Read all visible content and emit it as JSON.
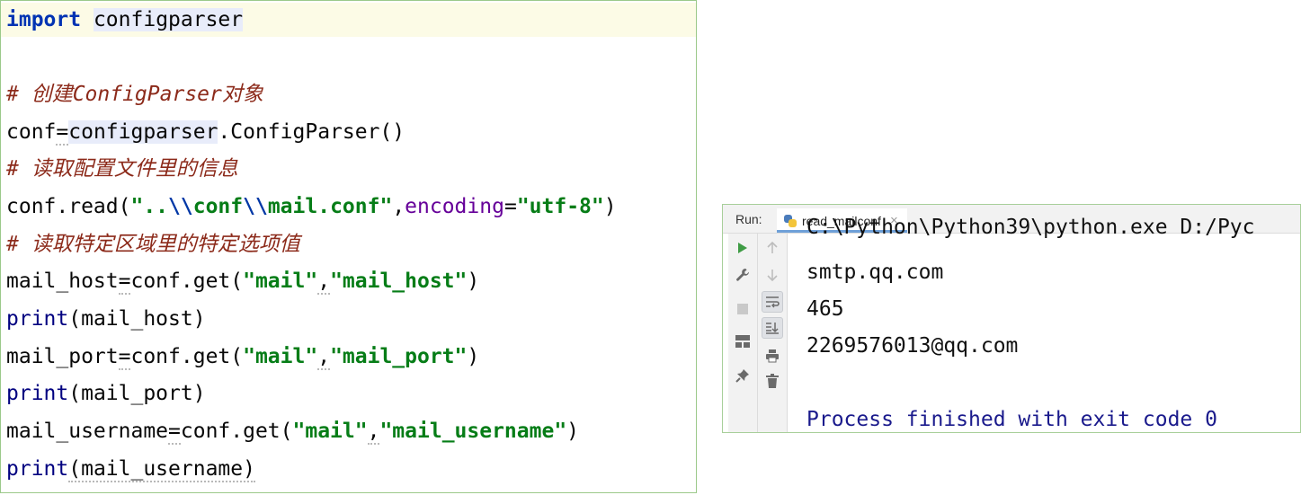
{
  "editor": {
    "lines": {
      "l1": {
        "kw": "import",
        "sp": " ",
        "mod": "configparser"
      },
      "l3": {
        "comment": "# 创建ConfigParser对象"
      },
      "l4": {
        "a": "conf",
        "eq": "=",
        "mod": "configparser",
        "rest": ".ConfigParser()"
      },
      "l5": {
        "comment": "# 读取配置文件里的信息"
      },
      "l6": {
        "a": "conf.read(",
        "s1": "\"..",
        "e1": "\\\\",
        "s2": "conf",
        "e2": "\\\\",
        "s3": "mail.conf\"",
        "comma": ",",
        "param": "encoding",
        "eq": "=",
        "s4": "\"utf-8\"",
        "close": ")"
      },
      "l7": {
        "comment": "# 读取特定区域里的特定选项值"
      },
      "l8": {
        "a": "mail_host",
        "eq": "=",
        "b": "conf.get(",
        "s1": "\"mail\"",
        "comma": ",",
        "s2": "\"mail_host\"",
        "close": ")"
      },
      "l9": {
        "fn": "print",
        "args": "(mail_host)"
      },
      "l10": {
        "a": "mail_port",
        "eq": "=",
        "b": "conf.get(",
        "s1": "\"mail\"",
        "comma": ",",
        "s2": "\"mail_port\"",
        "close": ")"
      },
      "l11": {
        "fn": "print",
        "args": "(mail_port)"
      },
      "l12": {
        "a": "mail_username",
        "eq": "=",
        "b": "conf.get(",
        "s1": "\"mail\"",
        "comma": ",",
        "s2": "\"mail_username\"",
        "close": ")"
      },
      "l13": {
        "fn": "print",
        "args": "(mail_username)"
      }
    }
  },
  "run": {
    "label": "Run:",
    "tab_label": "read_mailconf",
    "tab_close": "×",
    "console": {
      "cmd": "C:\\Python\\Python39\\python.exe D:/Pyc",
      "out1": "smtp.qq.com",
      "out2": "465",
      "out3": "2269576013@qq.com",
      "finished": "Process finished with exit code 0"
    }
  },
  "colors": {
    "keyword": "#0033b3",
    "string": "#067d17",
    "comment": "#8c2a1a",
    "builtin": "#000080",
    "param": "#660099",
    "process_text": "#1a1a8c",
    "panel_border": "#9bc98a"
  },
  "icons": {
    "gutter1": [
      "run-icon",
      "wrench-icon",
      "stop-icon",
      "layout-icon",
      "pin-icon"
    ],
    "gutter2": [
      "arrow-up-icon",
      "arrow-down-icon",
      "soft-wrap-icon",
      "scroll-to-end-icon",
      "print-icon",
      "trash-icon"
    ]
  }
}
